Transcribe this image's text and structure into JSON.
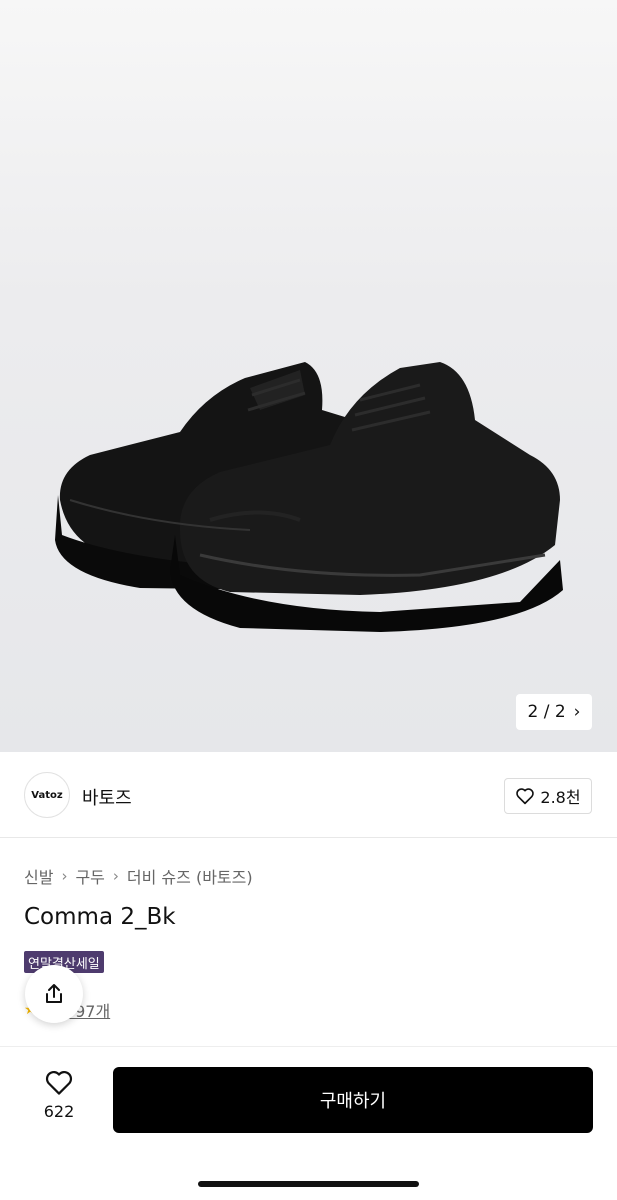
{
  "hero": {
    "image_alt": "black derby shoes",
    "pager_text": "2 / 2",
    "pager_icon": "chevron-right-icon"
  },
  "brand": {
    "logo_text": "Vatoz",
    "name": "바토즈",
    "likes": "2.8천",
    "like_icon": "heart-outline-icon"
  },
  "breadcrumb": [
    "신발",
    "구두",
    "더비 슈즈 (바토즈)"
  ],
  "product": {
    "title": "Comma 2_Bk",
    "sale_badge": "연말결산세일",
    "review_text": "후기 97개"
  },
  "bottom": {
    "wish_count": "622",
    "buy_label": "구매하기"
  },
  "colors": {
    "badge_bg": "#4e3b6e",
    "buy_bg": "#000000",
    "star": "#f5b800"
  }
}
